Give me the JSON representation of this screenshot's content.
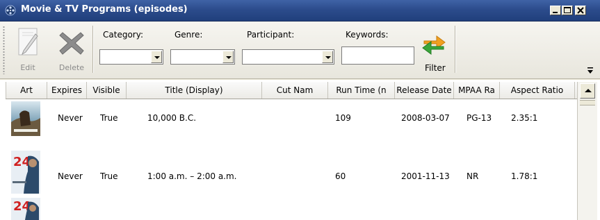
{
  "window": {
    "title": "Movie & TV Programs (episodes)",
    "icon": "film-reel-icon"
  },
  "toolbar": {
    "edit_label": "Edit",
    "delete_label": "Delete",
    "filter_label": "Filter",
    "category_label": "Category:",
    "genre_label": "Genre:",
    "participant_label": "Participant:",
    "keywords_label": "Keywords:",
    "category_value": "",
    "genre_value": "",
    "participant_value": "",
    "keywords_value": ""
  },
  "table": {
    "columns": [
      "Art",
      "Expires",
      "Visible",
      "Title (Display)",
      "Cut Nam",
      "Run Time (n",
      "Release Date",
      "MPAA Ra",
      "Aspect Ratio"
    ],
    "rows": [
      {
        "expires": "Never",
        "visible": "True",
        "title": "10,000 B.C.",
        "cut_name": "",
        "run_time": "109",
        "release_date": "2008-03-07",
        "mpaa": "PG-13",
        "aspect": "2.35:1",
        "art": "poster-10000bc"
      },
      {
        "expires": "Never",
        "visible": "True",
        "title": "1:00 a.m. – 2:00 a.m.",
        "cut_name": "",
        "run_time": "60",
        "release_date": "2001-11-13",
        "mpaa": "NR",
        "aspect": "1.78:1",
        "art": "poster-24"
      },
      {
        "expires": "",
        "visible": "",
        "title": "",
        "cut_name": "",
        "run_time": "",
        "release_date": "",
        "mpaa": "",
        "aspect": "",
        "art": "poster-24"
      }
    ]
  },
  "colors": {
    "titlebar": "#2c4c8c",
    "toolbar": "#ece9d8",
    "filter_orange": "#f0a020",
    "filter_green": "#3aa63a"
  }
}
